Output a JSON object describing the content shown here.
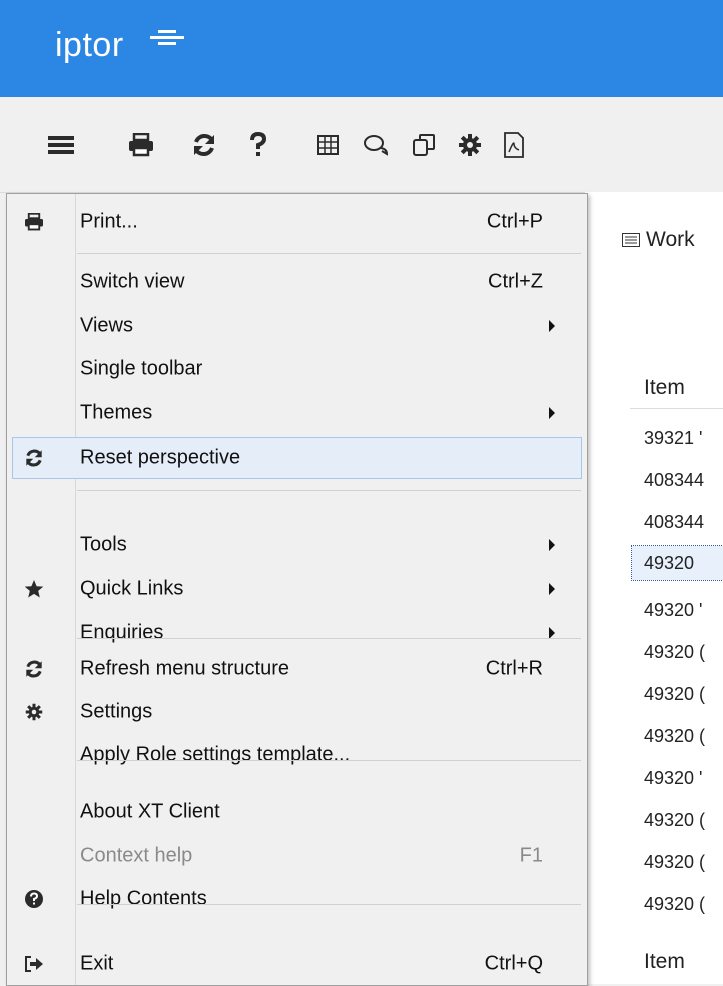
{
  "app": {
    "logo_text": "iptor",
    "brand_color": "#2b87e3"
  },
  "toolbar": {
    "icons": [
      "menu-icon",
      "print-icon",
      "refresh-icon",
      "help-icon",
      "table-icon",
      "chat-icon",
      "copy-icon",
      "gear-icon",
      "pdf-icon"
    ]
  },
  "menu": {
    "items": [
      {
        "label": "Print...",
        "shortcut": "Ctrl+P",
        "icon": "print-icon"
      },
      {
        "label": "Switch view",
        "shortcut": "Ctrl+Z"
      },
      {
        "label": "Views",
        "submenu": true
      },
      {
        "label": "Single toolbar"
      },
      {
        "label": "Themes",
        "submenu": true
      },
      {
        "label": "Reset perspective",
        "icon": "refresh-icon",
        "highlighted": true
      },
      {
        "label": "Tools",
        "submenu": true
      },
      {
        "label": "Quick Links",
        "icon": "star-icon",
        "submenu": true
      },
      {
        "label": "Enquiries",
        "submenu": true
      },
      {
        "label": "Refresh menu structure",
        "shortcut": "Ctrl+R",
        "icon": "refresh-icon"
      },
      {
        "label": "Settings",
        "icon": "gear-icon"
      },
      {
        "label": "Apply Role settings template..."
      },
      {
        "label": "About XT Client"
      },
      {
        "label": "Context help",
        "shortcut": "F1",
        "disabled": true
      },
      {
        "label": "Help Contents",
        "icon": "help-circle-icon"
      },
      {
        "label": "Exit",
        "shortcut": "Ctrl+Q",
        "icon": "exit-icon"
      }
    ]
  },
  "content": {
    "tab_label": "Work",
    "column_header": "Item",
    "rows": [
      "39321 '",
      "408344",
      "408344",
      "49320",
      "49320 '",
      "49320 (",
      "49320 (",
      "49320 (",
      "49320 '",
      "49320 (",
      "49320 (",
      "49320 ("
    ],
    "footer_label": "Item"
  }
}
